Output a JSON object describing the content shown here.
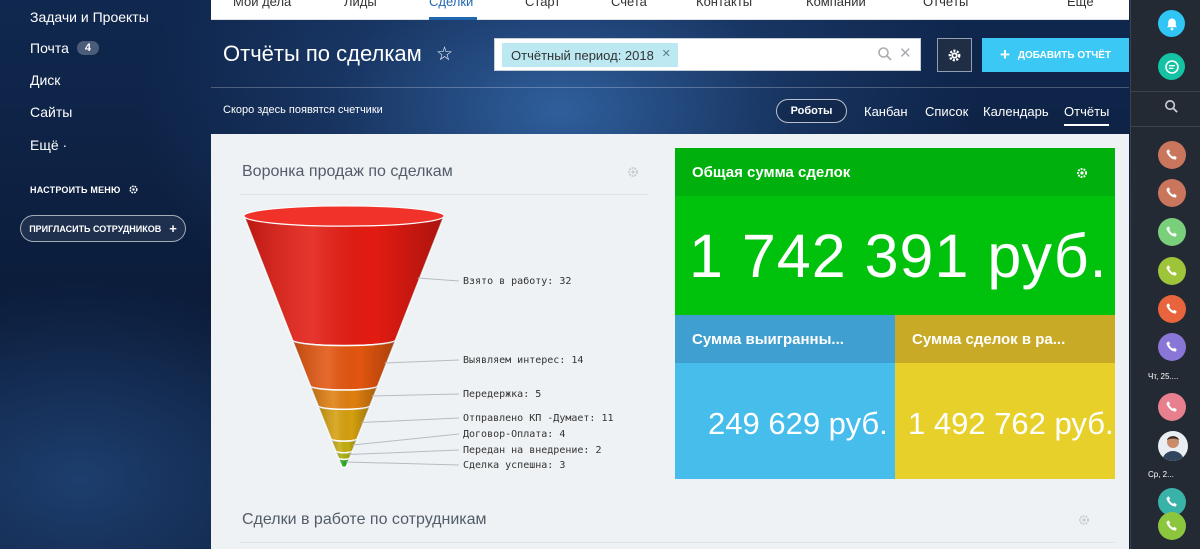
{
  "sidebar": {
    "items": [
      {
        "label": "Задачи и Проекты"
      },
      {
        "label": "Почта",
        "badge": "4"
      },
      {
        "label": "Диск"
      },
      {
        "label": "Сайты"
      },
      {
        "label": "Ещё ·"
      }
    ],
    "configure_menu": "НАСТРОИТЬ МЕНЮ",
    "invite": "ПРИГЛАСИТЬ СОТРУДНИКОВ"
  },
  "topnav": {
    "tabs": [
      {
        "label": "Мой дела"
      },
      {
        "label": "Лиды"
      },
      {
        "label": "Сделки",
        "active": true
      },
      {
        "label": "Старт"
      },
      {
        "label": "Счета"
      },
      {
        "label": "Контакты"
      },
      {
        "label": "Компании"
      },
      {
        "label": "Отчёты"
      },
      {
        "label": "Ещё"
      }
    ]
  },
  "header": {
    "title": "Отчёты по сделкам",
    "filter_chip": "Отчётный период: 2018",
    "add_report": "ДОБАВИТЬ ОТЧЁТ",
    "counter_text": "Скоро здесь появятся счетчики"
  },
  "views": {
    "robots": "Роботы",
    "tabs": [
      "Канбан",
      "Список",
      "Календарь",
      "Отчёты"
    ],
    "active": "Отчёты"
  },
  "funnel": {
    "title": "Воронка продаж по сделкам",
    "stages": [
      {
        "label": "Взято в работу",
        "value": 32,
        "color": "#e31b12"
      },
      {
        "label": "Выявляем интерес",
        "value": 14,
        "color": "#e2550f"
      },
      {
        "label": "Передержка",
        "value": 5,
        "color": "#e07f10"
      },
      {
        "label": "Отправлено КП -Думает",
        "value": 11,
        "color": "#d59f0f"
      },
      {
        "label": "Договор-Оплата",
        "value": 4,
        "color": "#c4ad10"
      },
      {
        "label": "Передан на внедрение",
        "value": 2,
        "color": "#a8b010"
      },
      {
        "label": "Сделка успешна",
        "value": 3,
        "color": "#2aa71b"
      }
    ]
  },
  "tiles": {
    "total": {
      "title": "Общая сумма сделок",
      "value": "1 742 391 руб.",
      "color": "#00c20d",
      "head_color": "#00b00c"
    },
    "won": {
      "title": "Сумма выигранны...",
      "value": "249 629 руб.",
      "color": "#47bdec",
      "head_color": "#3f9fd0"
    },
    "inwork": {
      "title": "Сумма сделок в ра...",
      "value": "1 492 762 руб.",
      "color": "#e8d02a",
      "head_color": "#c9aa26"
    }
  },
  "employees_section": {
    "title": "Сделки в работе по сотрудникам"
  },
  "rightbar": {
    "dates": [
      "Чт, 25....",
      "Ср, 2..."
    ],
    "call_colors": [
      "#c9765c",
      "#c9765c",
      "#7ad07a",
      "#9ec43a",
      "#e8643d",
      "#8a76d6",
      "#e87f8e",
      "#39b3a8",
      "#8cc63f"
    ]
  }
}
